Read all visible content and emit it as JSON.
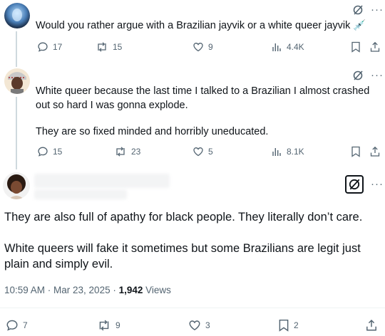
{
  "reply1": {
    "text": "Would you rather argue with a Brazilian jayvik or a white queer jayvik 💉",
    "replies": "17",
    "reposts": "15",
    "likes": "9",
    "views": "4.4K"
  },
  "reply2": {
    "paragraphs": [
      "White queer because the last time I talked to a Brazilian I almost crashed out so hard I was gonna explode.",
      "They are so fixed minded and horribly uneducated."
    ],
    "replies": "15",
    "reposts": "23",
    "likes": "5",
    "views": "8.1K"
  },
  "main": {
    "paragraphs": [
      "They are also full of apathy for black people. They literally don’t care.",
      "White queers will fake it sometimes but some Brazilians are legit just plain and simply evil."
    ],
    "timestamp": "10:59 AM · Mar 23, 2025 · ",
    "views_count": "1,942",
    "views_label": " Views",
    "replies": "7",
    "reposts": "9",
    "likes": "3",
    "bookmarks": "2"
  },
  "icons": {
    "more": "···"
  }
}
